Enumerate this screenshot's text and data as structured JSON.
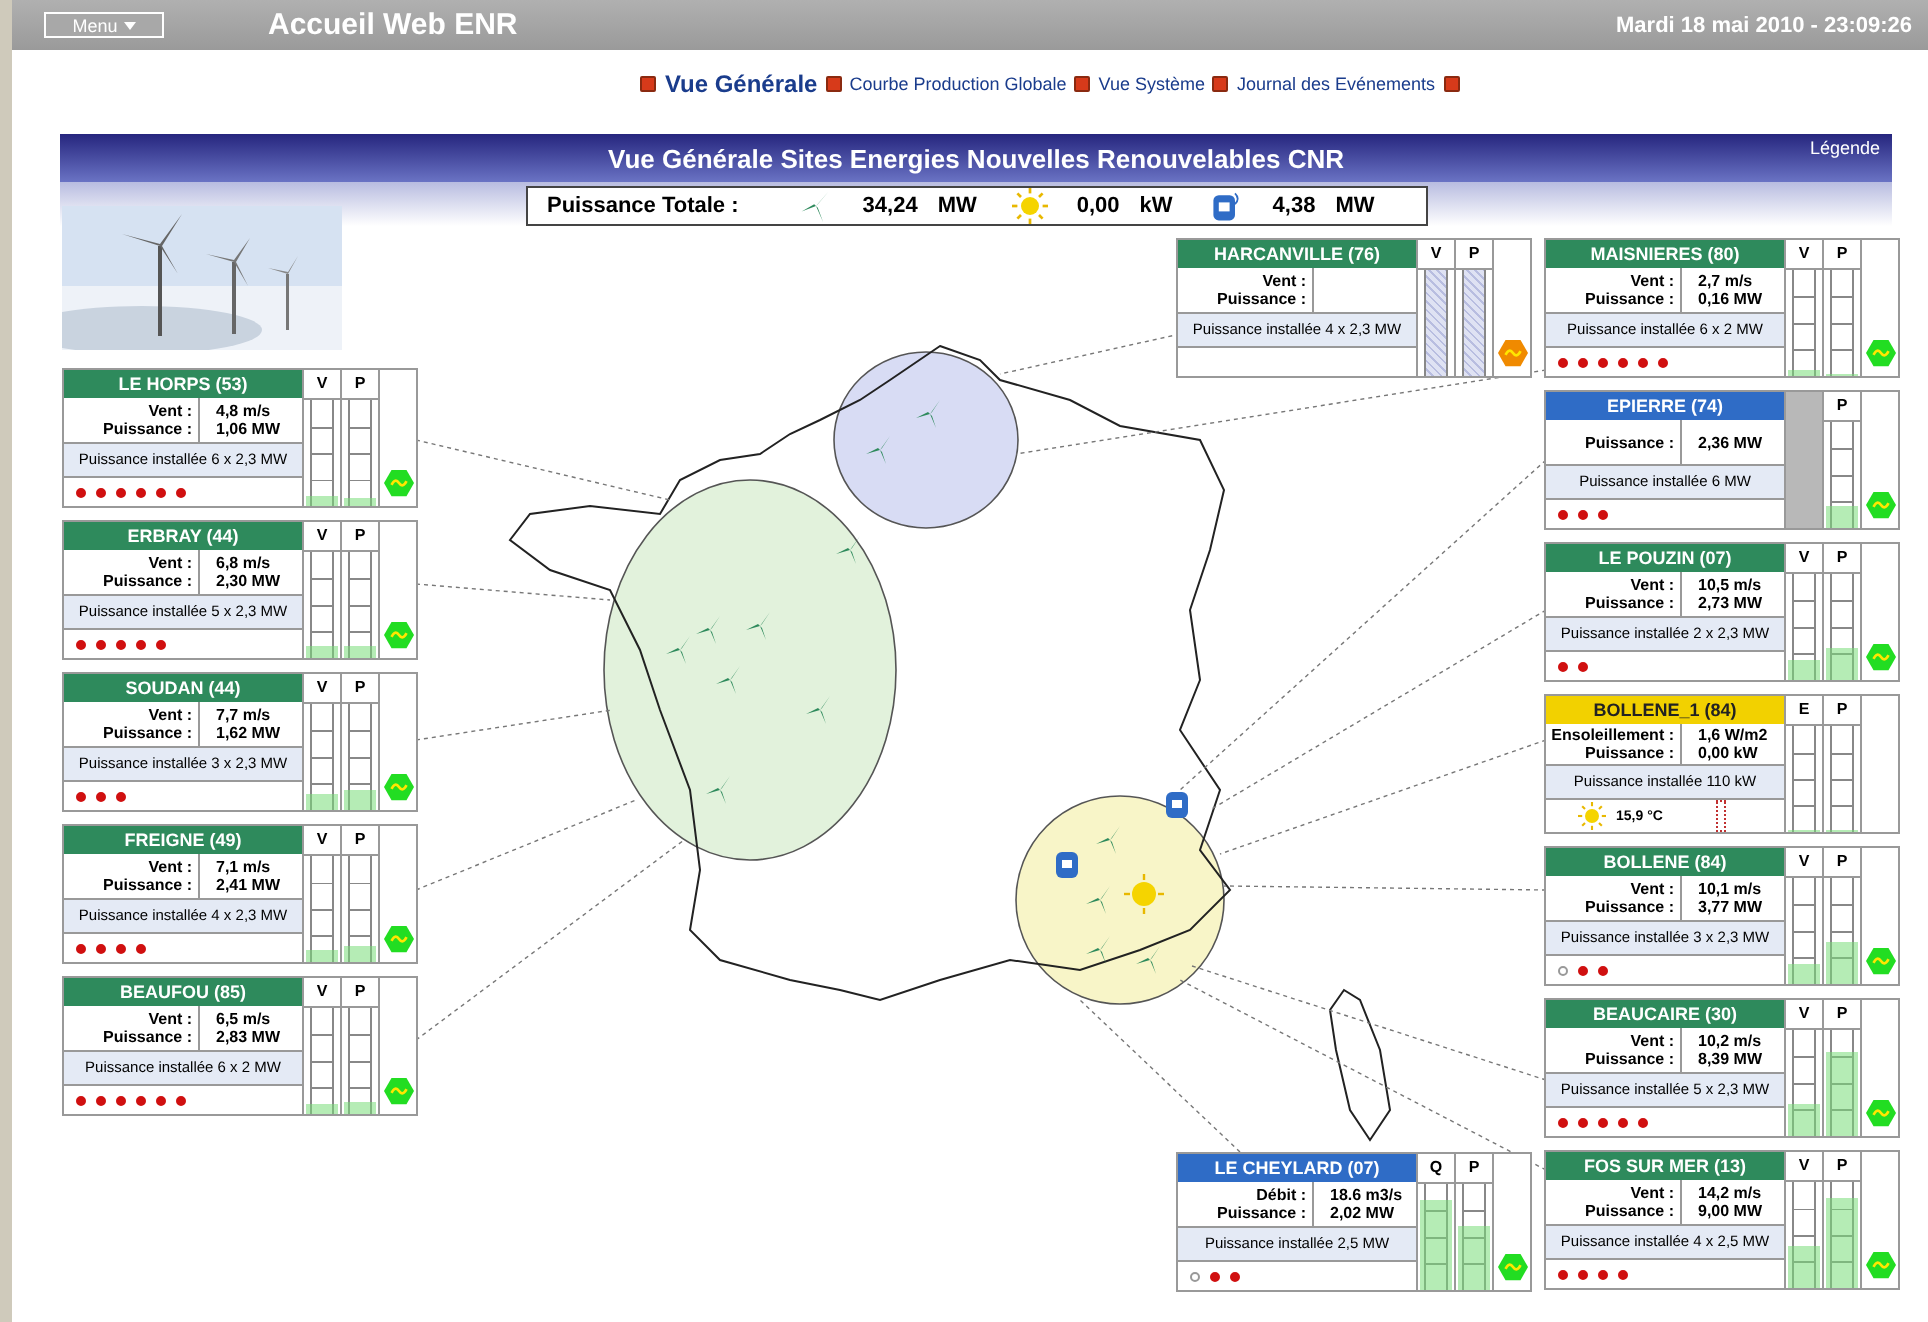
{
  "top_bar": {
    "menu_button": "Menu",
    "title": "Accueil Web ENR",
    "datetime": "Mardi 18 mai 2010 - 23:09:26"
  },
  "nav": [
    {
      "label": "Vue Générale",
      "selected": true
    },
    {
      "label": "Courbe Production Globale",
      "selected": false
    },
    {
      "label": "Vue Système",
      "selected": false
    },
    {
      "label": "Journal des Evénements",
      "selected": false
    }
  ],
  "banner": {
    "title": "Vue Générale Sites Energies Nouvelles Renouvelables CNR",
    "legend_link": "Légende"
  },
  "total": {
    "label": "Puissance Totale :",
    "items": [
      {
        "kind": "wind",
        "value": "34,24",
        "unit": "MW"
      },
      {
        "kind": "solar",
        "value": "0,00",
        "unit": "kW"
      },
      {
        "kind": "hydro",
        "value": "4,38",
        "unit": "MW"
      }
    ]
  },
  "left_sites": [
    {
      "title": "LE HORPS (53)",
      "kind": "wind",
      "fields": [
        {
          "label": "Vent :",
          "value": "4,8 m/s"
        },
        {
          "label": "Puissance :",
          "value": "1,06 MW"
        }
      ],
      "installed": "Puissance installée 6 x 2,3 MW",
      "dots": [
        {
          "active": true
        },
        {
          "active": true
        },
        {
          "active": true
        },
        {
          "active": true
        },
        {
          "active": true
        },
        {
          "active": true
        }
      ],
      "gauges": [
        {
          "kind": "meter",
          "label": "V",
          "level": 0.1
        },
        {
          "kind": "meter",
          "label": "P",
          "level": 0.08
        }
      ],
      "status": {
        "color": "#22dd22"
      }
    },
    {
      "title": "ERBRAY (44)",
      "kind": "wind",
      "fields": [
        {
          "label": "Vent :",
          "value": "6,8 m/s"
        },
        {
          "label": "Puissance :",
          "value": "2,30 MW"
        }
      ],
      "installed": "Puissance installée 5 x 2,3 MW",
      "dots": [
        {
          "active": true
        },
        {
          "active": true
        },
        {
          "active": true
        },
        {
          "active": true
        },
        {
          "active": true
        }
      ],
      "gauges": [
        {
          "kind": "meter",
          "label": "V",
          "level": 0.12
        },
        {
          "kind": "meter",
          "label": "P",
          "level": 0.12
        }
      ],
      "status": {
        "color": "#22dd22"
      }
    },
    {
      "title": "SOUDAN (44)",
      "kind": "wind",
      "fields": [
        {
          "label": "Vent :",
          "value": "7,7 m/s"
        },
        {
          "label": "Puissance :",
          "value": "1,62 MW"
        }
      ],
      "installed": "Puissance installée 3 x 2,3 MW",
      "dots": [
        {
          "active": true
        },
        {
          "active": true
        },
        {
          "active": true
        }
      ],
      "gauges": [
        {
          "kind": "meter",
          "label": "V",
          "level": 0.15
        },
        {
          "kind": "meter",
          "label": "P",
          "level": 0.18
        }
      ],
      "status": {
        "color": "#22dd22"
      }
    },
    {
      "title": "FREIGNE (49)",
      "kind": "wind",
      "fields": [
        {
          "label": "Vent :",
          "value": "7,1 m/s"
        },
        {
          "label": "Puissance :",
          "value": "2,41 MW"
        }
      ],
      "installed": "Puissance installée 4 x 2,3 MW",
      "dots": [
        {
          "active": true
        },
        {
          "active": true
        },
        {
          "active": true
        },
        {
          "active": true
        }
      ],
      "gauges": [
        {
          "kind": "meter",
          "label": "V",
          "level": 0.12
        },
        {
          "kind": "meter",
          "label": "P",
          "level": 0.15
        }
      ],
      "status": {
        "color": "#22dd22"
      }
    },
    {
      "title": "BEAUFOU (85)",
      "kind": "wind",
      "fields": [
        {
          "label": "Vent :",
          "value": "6,5 m/s"
        },
        {
          "label": "Puissance :",
          "value": "2,83 MW"
        }
      ],
      "installed": "Puissance installée 6 x 2 MW",
      "dots": [
        {
          "active": true
        },
        {
          "active": true
        },
        {
          "active": true
        },
        {
          "active": true
        },
        {
          "active": true
        },
        {
          "active": true
        }
      ],
      "gauges": [
        {
          "kind": "meter",
          "label": "V",
          "level": 0.1
        },
        {
          "kind": "meter",
          "label": "P",
          "level": 0.12
        }
      ],
      "status": {
        "color": "#22dd22"
      }
    }
  ],
  "center_sites": [
    {
      "title": "HARCANVILLE (76)",
      "kind": "wind",
      "fields": [
        {
          "label": "Vent :"
        },
        {
          "label": "Puissance :"
        }
      ],
      "installed": "Puissance installée 4 x 2,3 MW",
      "gauges": [
        {
          "kind": "nodata",
          "label": "V"
        },
        {
          "kind": "nodata",
          "label": "P"
        }
      ],
      "status": {
        "color": "#f08a00"
      }
    },
    {
      "title": "LE CHEYLARD (07)",
      "kind": "hydro",
      "fields": [
        {
          "label": "Débit :",
          "value": "18.6 m3/s"
        },
        {
          "label": "Puissance :",
          "value": "2,02 MW"
        }
      ],
      "installed": "Puissance installée 2,5 MW",
      "dots": [
        {
          "active": false
        },
        {
          "active": true
        },
        {
          "active": true
        }
      ],
      "gauges": [
        {
          "kind": "meter",
          "label": "Q",
          "level": 0.85
        },
        {
          "kind": "meter",
          "label": "P",
          "level": 0.6
        }
      ],
      "status": {
        "color": "#22dd22"
      }
    }
  ],
  "right_sites": [
    {
      "title": "MAISNIERES (80)",
      "kind": "wind",
      "fields": [
        {
          "label": "Vent :",
          "value": "2,7 m/s"
        },
        {
          "label": "Puissance :",
          "value": "0,16 MW"
        }
      ],
      "installed": "Puissance installée 6 x 2 MW",
      "dots": [
        {
          "active": true
        },
        {
          "active": true
        },
        {
          "active": true
        },
        {
          "active": true
        },
        {
          "active": true
        },
        {
          "active": true
        }
      ],
      "gauges": [
        {
          "kind": "meter",
          "label": "V",
          "level": 0.06
        },
        {
          "kind": "meter",
          "label": "P",
          "level": 0
        }
      ],
      "status": {
        "color": "#22dd22"
      }
    },
    {
      "title": "EPIERRE (74)",
      "kind": "hydro",
      "fields": [
        {
          "label": "Puissance :",
          "value": "2,36 MW"
        }
      ],
      "installed": "Puissance installée 6 MW",
      "dots": [
        {
          "active": true
        },
        {
          "active": true
        },
        {
          "active": true
        }
      ],
      "gauges": [
        {
          "kind": "blank"
        },
        {
          "kind": "meter",
          "label": "P",
          "level": 0.2
        }
      ],
      "status": {
        "color": "#22dd22"
      }
    },
    {
      "title": "LE POUZIN (07)",
      "kind": "wind",
      "fields": [
        {
          "label": "Vent :",
          "value": "10,5 m/s"
        },
        {
          "label": "Puissance :",
          "value": "2,73 MW"
        }
      ],
      "installed": "Puissance installée 2 x 2,3 MW",
      "dots": [
        {
          "active": true
        },
        {
          "active": true
        }
      ],
      "gauges": [
        {
          "kind": "meter",
          "label": "V",
          "level": 0.18
        },
        {
          "kind": "meter",
          "label": "P",
          "level": 0.3
        }
      ],
      "status": {
        "color": "#22dd22"
      }
    },
    {
      "title": "BOLLENE_1 (84)",
      "kind": "solar",
      "fields": [
        {
          "label": "Ensoleillement :",
          "value": "1,6 W/m2"
        },
        {
          "label": "Puissance :",
          "value": "0,00 kW"
        }
      ],
      "installed": "Puissance installée 110 kW",
      "temperature": "15,9 °C",
      "gauges": [
        {
          "kind": "meter",
          "label": "E",
          "level": 0
        },
        {
          "kind": "meter",
          "label": "P",
          "level": 0
        }
      ]
    },
    {
      "title": "BOLLENE (84)",
      "kind": "wind",
      "fields": [
        {
          "label": "Vent :",
          "value": "10,1 m/s"
        },
        {
          "label": "Puissance :",
          "value": "3,77 MW"
        }
      ],
      "installed": "Puissance installée 3 x 2,3 MW",
      "dots": [
        {
          "active": false
        },
        {
          "active": true
        },
        {
          "active": true
        }
      ],
      "gauges": [
        {
          "kind": "meter",
          "label": "V",
          "level": 0.18
        },
        {
          "kind": "meter",
          "label": "P",
          "level": 0.4
        }
      ],
      "status": {
        "color": "#22dd22"
      }
    },
    {
      "title": "BEAUCAIRE (30)",
      "kind": "wind",
      "fields": [
        {
          "label": "Vent :",
          "value": "10,2 m/s"
        },
        {
          "label": "Puissance :",
          "value": "8,39 MW"
        }
      ],
      "installed": "Puissance installée 5 x 2,3 MW",
      "dots": [
        {
          "active": true
        },
        {
          "active": true
        },
        {
          "active": true
        },
        {
          "active": true
        },
        {
          "active": true
        }
      ],
      "gauges": [
        {
          "kind": "meter",
          "label": "V",
          "level": 0.3
        },
        {
          "kind": "meter",
          "label": "P",
          "level": 0.8
        }
      ],
      "status": {
        "color": "#22dd22"
      }
    },
    {
      "title": "FOS SUR MER (13)",
      "kind": "wind",
      "fields": [
        {
          "label": "Vent :",
          "value": "14,2 m/s"
        },
        {
          "label": "Puissance :",
          "value": "9,00 MW"
        }
      ],
      "installed": "Puissance installée 4 x 2,5 MW",
      "dots": [
        {
          "active": true
        },
        {
          "active": true
        },
        {
          "active": true
        },
        {
          "active": true
        }
      ],
      "gauges": [
        {
          "kind": "meter",
          "label": "V",
          "level": 0.4
        },
        {
          "kind": "meter",
          "label": "P",
          "level": 0.85
        }
      ],
      "status": {
        "color": "#22dd22"
      }
    }
  ]
}
